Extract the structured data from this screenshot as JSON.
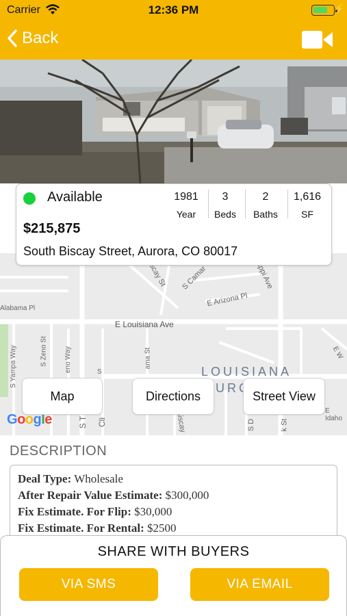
{
  "status_bar": {
    "carrier": "Carrier",
    "time": "12:36 PM"
  },
  "nav": {
    "back_label": "Back",
    "video_icon": "video-camera-icon"
  },
  "listing": {
    "status": "Available",
    "status_color": "#19d13b",
    "price": "$215,875",
    "address": "South Biscay Street, Aurora, CO 80017",
    "stats": [
      {
        "value": "1981",
        "label": "Year"
      },
      {
        "value": "3",
        "label": "Beds"
      },
      {
        "value": "2",
        "label": "Baths"
      },
      {
        "value": "1,616",
        "label": "SF"
      }
    ]
  },
  "map": {
    "labels": {
      "alabama": "Alabama Pl",
      "louisiana_ave": "E Louisiana Ave",
      "arizona": "E Arizona Pl",
      "camargo": "S Camar",
      "biscay_st": "scay St",
      "ippi": "ippi Ave",
      "louisiana_area": "LOUISIANA",
      "louisiana_area2": "URC",
      "zeno": "S Zeno St",
      "yampa": "S Yampa Way",
      "eno_way": "eno Way",
      "alameda_st": "ama St",
      "cli": "Cli",
      "biscay2": "Biscay",
      "s_d": "S D",
      "k_st": "k St",
      "idaho": "E Idaho",
      "e_w": "E W",
      "s_t": "S T",
      "s_mini": "S"
    },
    "buttons": {
      "map": "Map",
      "directions": "Directions",
      "street_view": "Street View"
    },
    "google": [
      "G",
      "o",
      "o",
      "g",
      "l",
      "e"
    ]
  },
  "description": {
    "title": "DESCRIPTION",
    "lines": [
      {
        "key": "Deal Type:",
        "value": "Wholesale"
      },
      {
        "key": "After Repair Value Estimate:",
        "value": "$300,000"
      },
      {
        "key": "Fix Estimate. For Flip:",
        "value": "$30,000"
      },
      {
        "key": "Fix Estimate. For Rental:",
        "value": "$2500"
      }
    ]
  },
  "share": {
    "title": "SHARE WITH BUYERS",
    "sms_label": "VIA SMS",
    "email_label": "VIA EMAIL"
  },
  "colors": {
    "accent": "#f5b700",
    "available": "#19d13b"
  }
}
